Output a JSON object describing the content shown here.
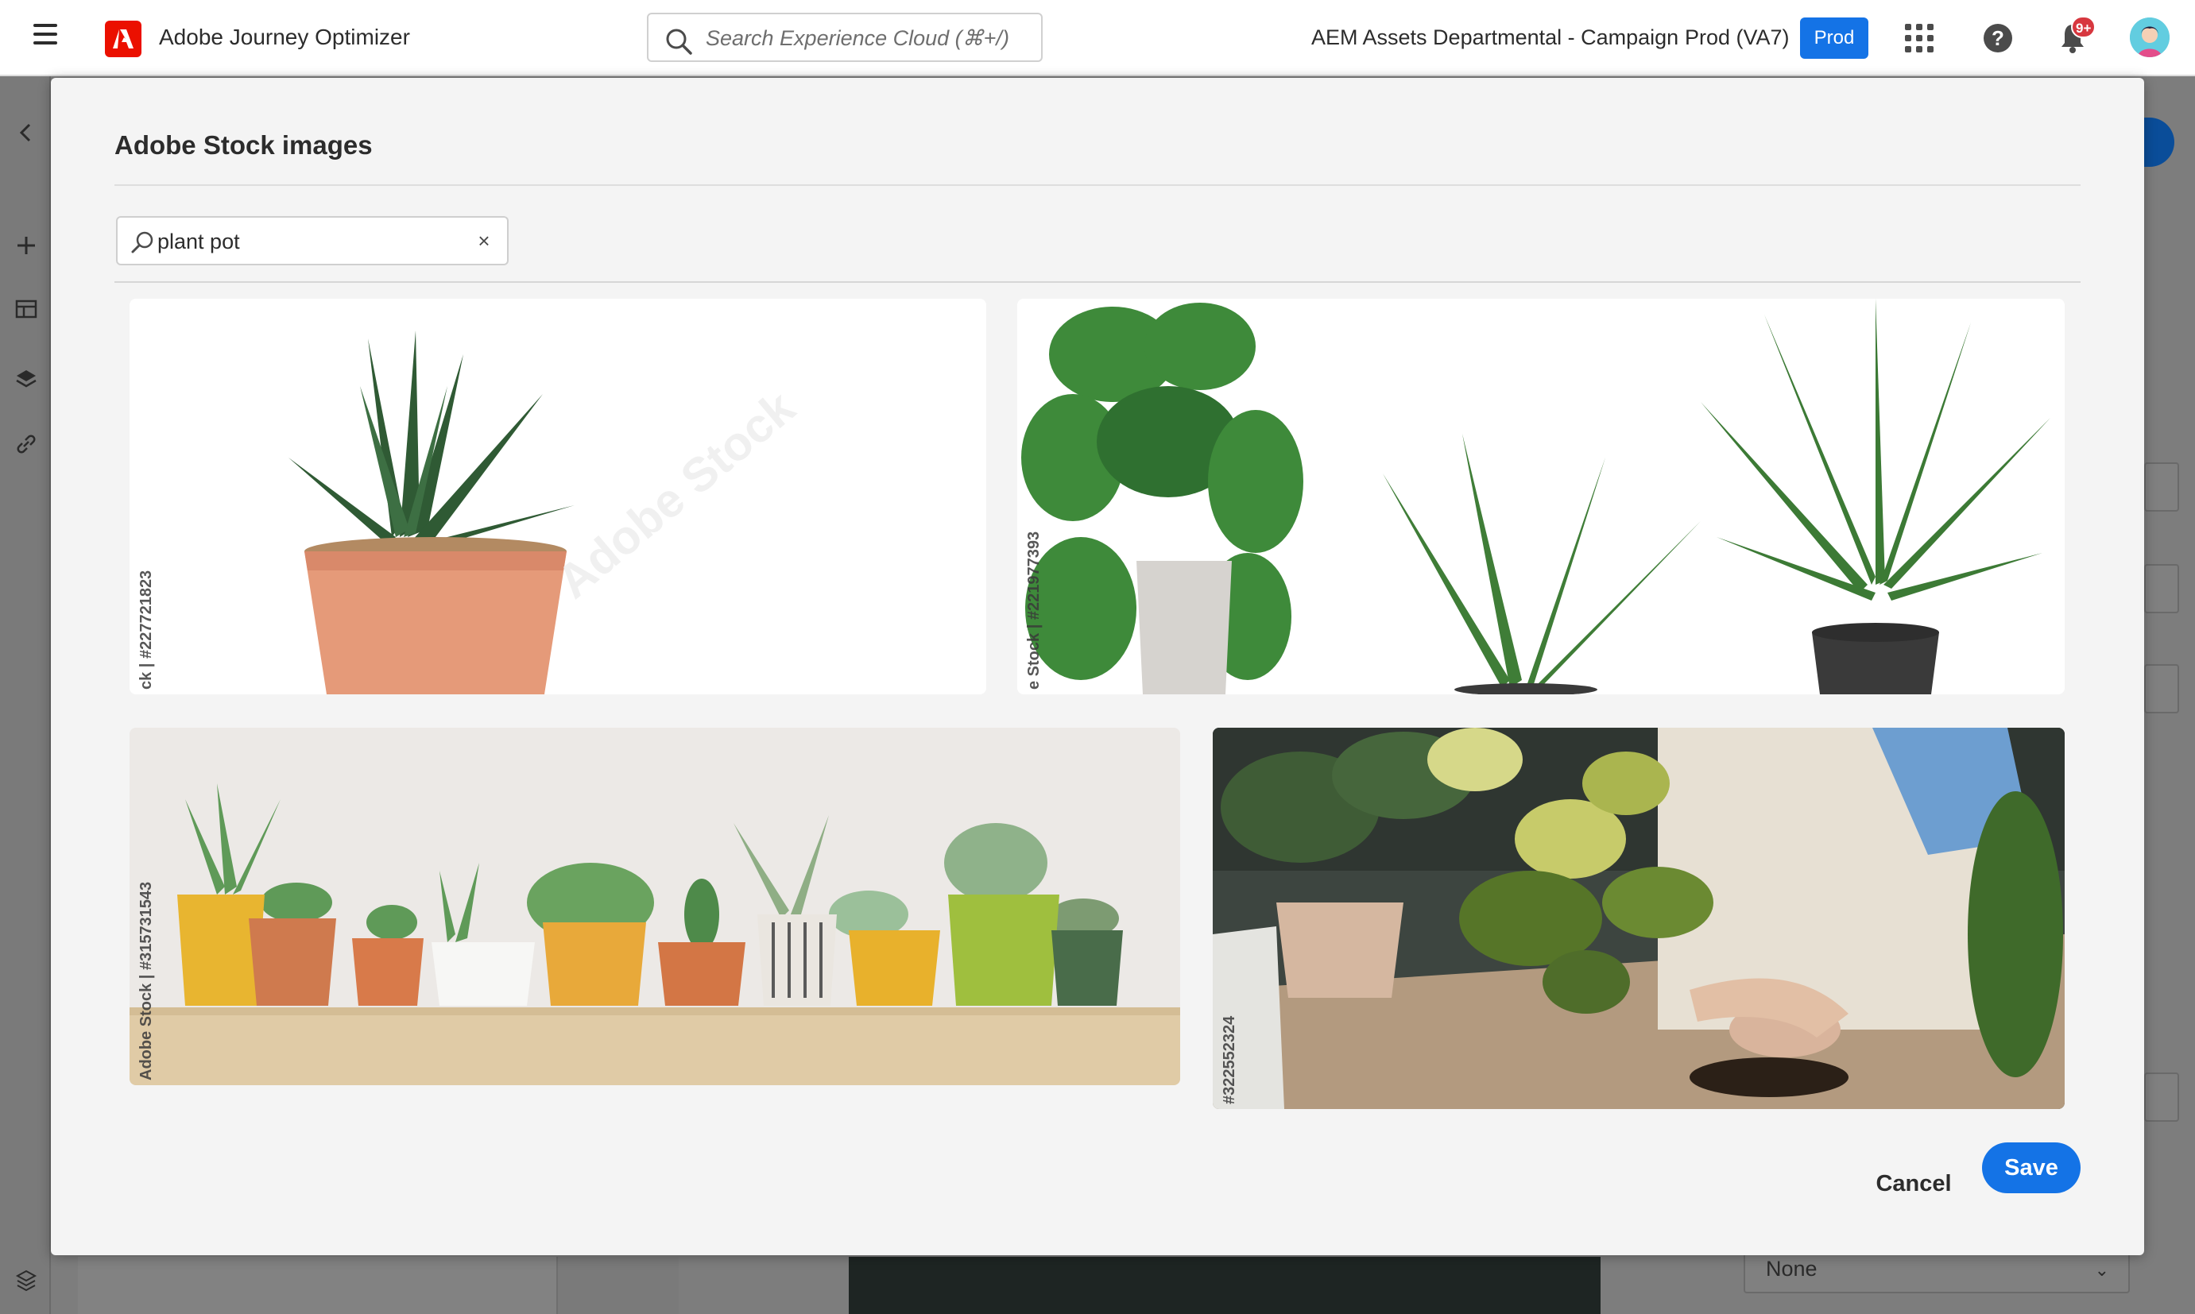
{
  "shell": {
    "app_title": "Adobe Journey Optimizer",
    "search_placeholder": "Search Experience Cloud (⌘+/)",
    "org_name": "AEM Assets Departmental - Campaign",
    "sandbox_name": "Prod (VA7)",
    "sandbox_badge": "Prod",
    "notification_count": "9+",
    "brand_color": "#eb1000",
    "accent_color": "#1473e6"
  },
  "background": {
    "dropdown_value": "None"
  },
  "modal": {
    "title": "Adobe Stock images",
    "search_value": "plant pot",
    "clear_icon": "×",
    "cancel_label": "Cancel",
    "save_label": "Save",
    "images": [
      {
        "subject": "aloe succulent in terracotta pot",
        "watermark": "ck | #227721823"
      },
      {
        "subject": "monstera, snake plant and palm in pots",
        "watermark": "e Stock | #221977393"
      },
      {
        "subject": "row of small succulents in colorful pots",
        "watermark": "Adobe Stock | #315731543"
      },
      {
        "subject": "hands repotting an anthurium plant",
        "watermark": "#322552324"
      }
    ]
  }
}
